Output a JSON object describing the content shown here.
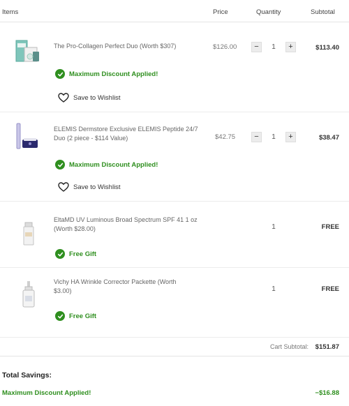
{
  "header": {
    "items": "Items",
    "price": "Price",
    "quantity": "Quantity",
    "subtotal": "Subtotal"
  },
  "items": [
    {
      "name": "The Pro-Collagen Perfect Duo (Worth $307)",
      "price": "$126.00",
      "qty": "1",
      "subtotal": "$113.40",
      "promo": "Maximum Discount Applied!",
      "wishlist": "Save to Wishlist"
    },
    {
      "name_line1": "ELEMIS Dermstore Exclusive ELEMIS Peptide 24/7",
      "name_line2": "Duo (2 piece - $114 Value)",
      "price": "$42.75",
      "qty": "1",
      "subtotal": "$38.47",
      "promo": "Maximum Discount Applied!",
      "wishlist": "Save to Wishlist"
    },
    {
      "name_line1": "EltaMD UV Luminous Broad Spectrum SPF 41 1 oz",
      "name_line2": "(Worth $28.00)",
      "qty": "1",
      "subtotal": "FREE",
      "promo": "Free Gift"
    },
    {
      "name_line1": "Vichy HA Wrinkle Corrector Packette (Worth",
      "name_line2": "$3.00)",
      "qty": "1",
      "subtotal": "FREE",
      "promo": "Free Gift"
    }
  ],
  "cart": {
    "subtotal_label": "Cart Subtotal:",
    "subtotal_value": "$151.87"
  },
  "savings": {
    "title": "Total Savings:",
    "label": "Maximum Discount Applied!",
    "value": "−$16.88"
  },
  "colors": {
    "promo_green": "#2f8f1f"
  }
}
